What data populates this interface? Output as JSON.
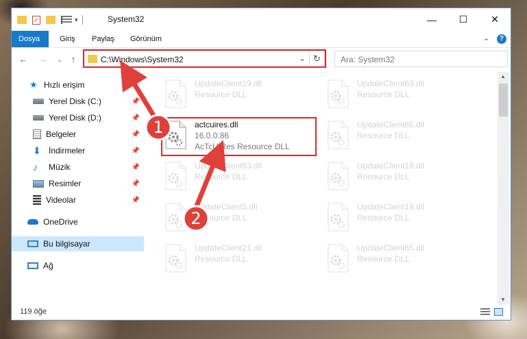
{
  "window": {
    "title": "System32",
    "controls": {
      "minimize": "—",
      "maximize": "☐",
      "close": "✕"
    }
  },
  "ribbon": {
    "tabs": [
      {
        "label": "Dosya",
        "active": true
      },
      {
        "label": "Giriş",
        "active": false
      },
      {
        "label": "Paylaş",
        "active": false
      },
      {
        "label": "Görünüm",
        "active": false
      }
    ],
    "expand_icon": "chevron-down-icon",
    "help_icon": "?"
  },
  "address": {
    "path": "C:\\Windows\\System32",
    "search_placeholder": "Ara: System32"
  },
  "nav": {
    "quick_access": "Hızlı erişim",
    "items": [
      {
        "label": "Yerel Disk (C:)",
        "icon": "drive-icon"
      },
      {
        "label": "Yerel Disk (D:)",
        "icon": "drive-icon"
      },
      {
        "label": "Belgeler",
        "icon": "documents-icon"
      },
      {
        "label": "İndirmeler",
        "icon": "download-icon"
      },
      {
        "label": "Müzik",
        "icon": "music-icon"
      },
      {
        "label": "Resimler",
        "icon": "pictures-icon"
      },
      {
        "label": "Videolar",
        "icon": "videos-icon"
      }
    ],
    "onedrive": "OneDrive",
    "this_pc": "Bu bilgisayar",
    "network": "Ağ"
  },
  "files": {
    "left": [
      {
        "name": "UpdateClient19.dll",
        "desc": "Resource DLL"
      },
      {
        "name": "actcuires.dll",
        "version": "16.0.0.86",
        "desc": "AcTcUiRes Resource DLL"
      },
      {
        "name": "UpdateClient63.dll",
        "desc": "Resource DLL"
      },
      {
        "name": "UpdateClient5.dll",
        "desc": "Resource DLL"
      },
      {
        "name": "UpdateClient21.dll",
        "desc": "Resource DLL"
      }
    ],
    "right": [
      {
        "name": "UpdateClient63.dll",
        "desc": "Resource DLL"
      },
      {
        "name": "UpdateClient65.dll",
        "desc": "Resource DLL"
      },
      {
        "name": "UpdateClient19.dll",
        "desc": "Resource DLL"
      },
      {
        "name": "UpdateClient19.dll",
        "desc": "Resource DLL"
      },
      {
        "name": "UpdateClient65.dll",
        "desc": "Resource DLL"
      }
    ]
  },
  "status": {
    "item_count": "119 öğe"
  },
  "annotations": {
    "step1": "1",
    "step2": "2",
    "color": "#e0403b"
  }
}
